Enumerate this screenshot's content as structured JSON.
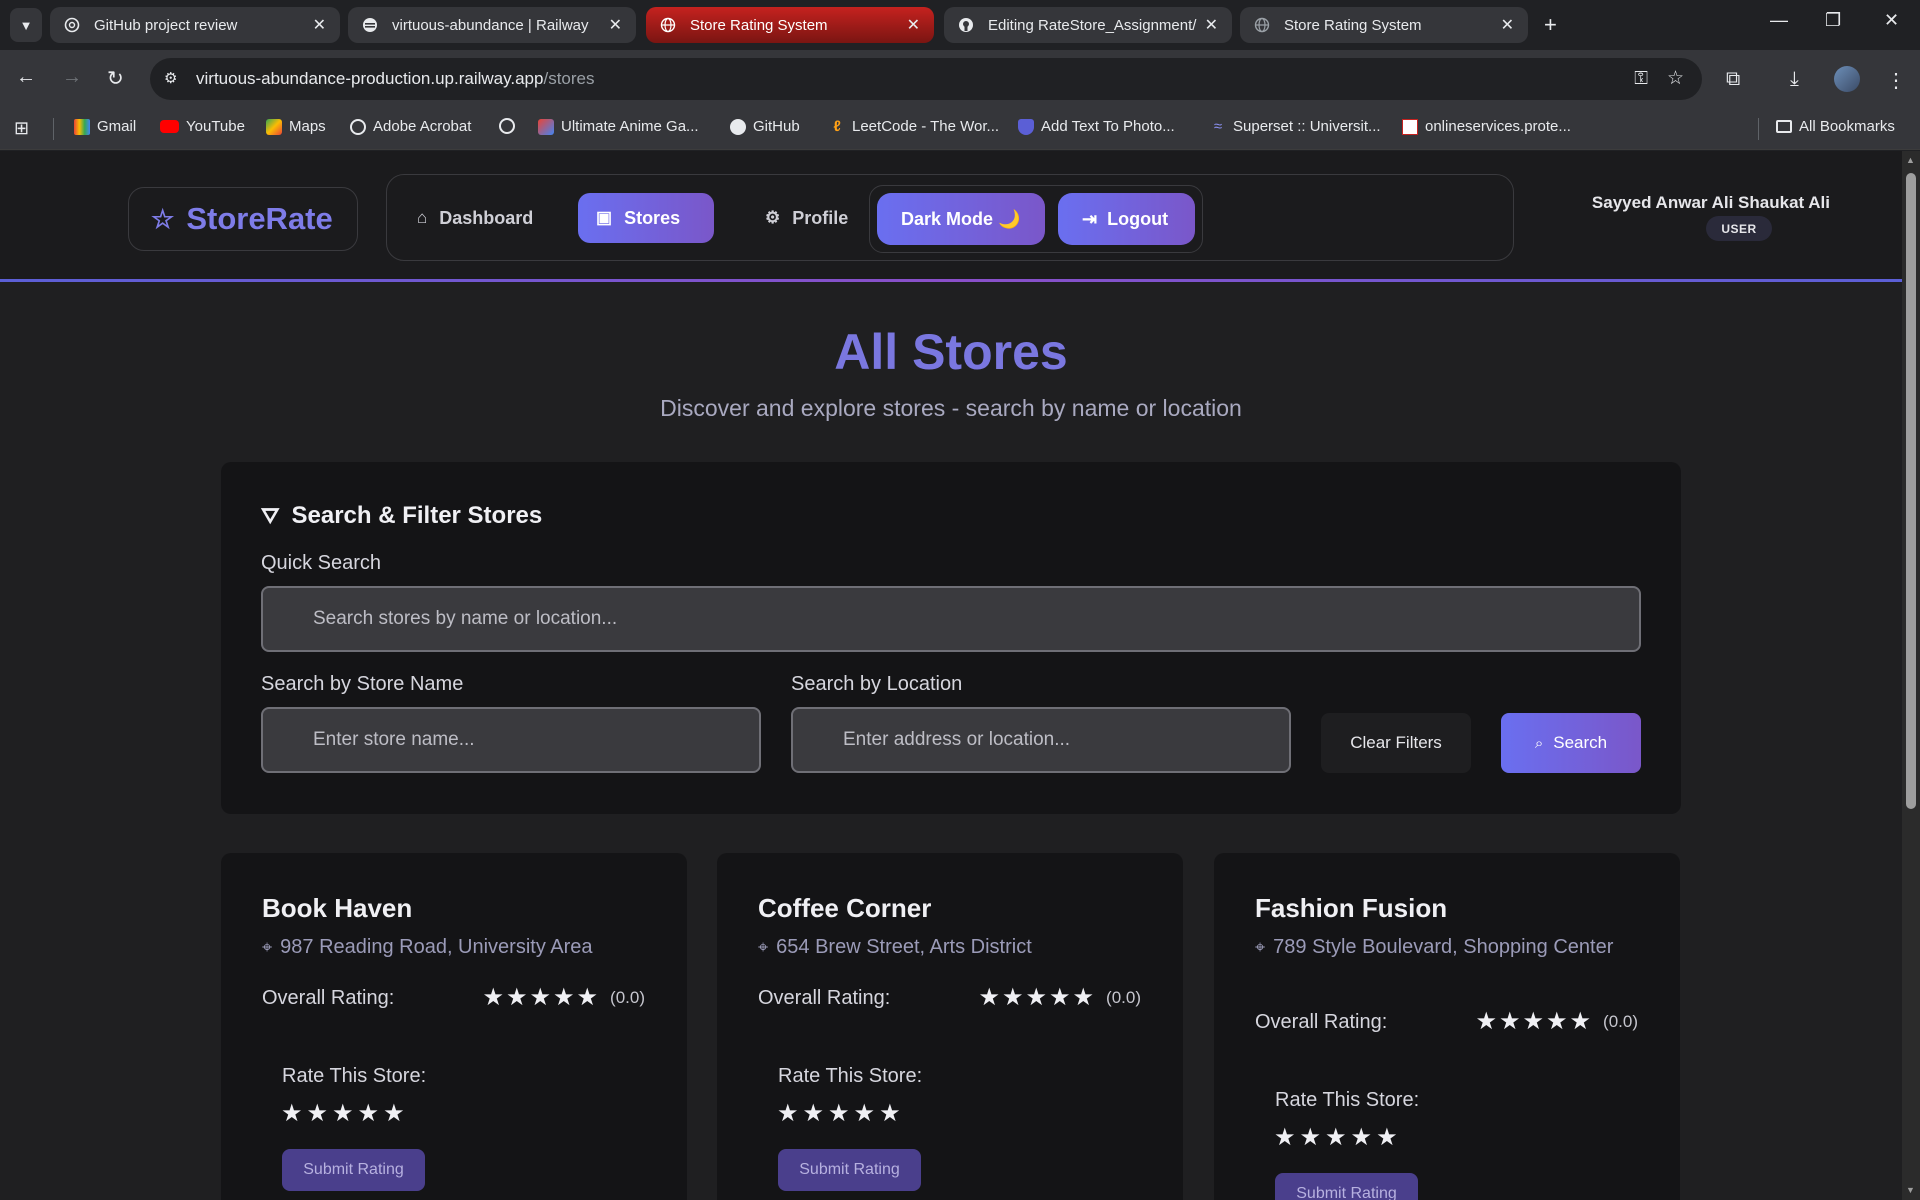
{
  "browser": {
    "tabs": [
      {
        "title": "GitHub project review",
        "icon": "chatgpt-icon"
      },
      {
        "title": "virtuous-abundance | Railway",
        "icon": "railway-icon"
      },
      {
        "title": "Store Rating System",
        "icon": "globe-icon",
        "active": true
      },
      {
        "title": "Editing RateStore_Assignment/",
        "icon": "github-icon"
      },
      {
        "title": "Store Rating System",
        "icon": "globe-icon"
      }
    ],
    "url_host": "virtuous-abundance-production.up.railway.app",
    "url_path": "/stores",
    "bookmarks": [
      "Gmail",
      "YouTube",
      "Maps",
      "Adobe Acrobat",
      "",
      "Ultimate Anime Ga...",
      "GitHub",
      "LeetCode - The Wor...",
      "Add Text To Photo...",
      "Superset :: Universit...",
      "onlineservices.prote..."
    ],
    "all_bookmarks": "All Bookmarks"
  },
  "header": {
    "logo": "StoreRate",
    "nav": {
      "dashboard": "Dashboard",
      "stores": "Stores",
      "profile": "Profile"
    },
    "dark_mode": "Dark Mode 🌙",
    "logout": "Logout",
    "user_name": "Sayyed Anwar Ali Shaukat Ali",
    "role": "USER"
  },
  "main": {
    "title": "All Stores",
    "subtitle": "Discover and explore stores - search by name or location"
  },
  "filters": {
    "title": "Search & Filter Stores",
    "quick_search_label": "Quick Search",
    "quick_search_placeholder": "Search stores by name or location...",
    "name_label": "Search by Store Name",
    "name_placeholder": "Enter store name...",
    "location_label": "Search by Location",
    "location_placeholder": "Enter address or location...",
    "clear": "Clear Filters",
    "search": "Search"
  },
  "stores": [
    {
      "name": "Book Haven",
      "address": "987 Reading Road, University Area",
      "overall_label": "Overall Rating:",
      "rating": "(0.0)",
      "rate_label": "Rate This Store:",
      "submit": "Submit Rating"
    },
    {
      "name": "Coffee Corner",
      "address": "654 Brew Street, Arts District",
      "overall_label": "Overall Rating:",
      "rating": "(0.0)",
      "rate_label": "Rate This Store:",
      "submit": "Submit Rating"
    },
    {
      "name": "Fashion Fusion",
      "address": "789 Style Boulevard, Shopping Center",
      "overall_label": "Overall Rating:",
      "rating": "(0.0)",
      "rate_label": "Rate This Store:",
      "submit": "Submit Rating"
    }
  ],
  "colors": {
    "accent": "#6a6ff0",
    "accent2": "#7a57c9",
    "active_tab": "#c5221f"
  }
}
